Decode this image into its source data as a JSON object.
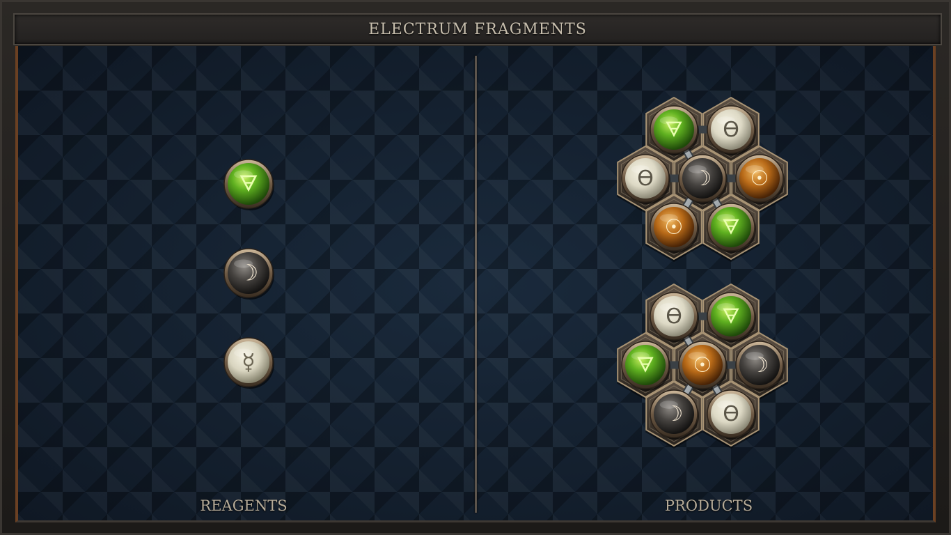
{
  "title": "ELECTRUM FRAGMENTS",
  "panels": {
    "reagents": {
      "label": "REAGENTS"
    },
    "products": {
      "label": "PRODUCTS"
    }
  },
  "colors": {
    "salt_green": "#5fb020",
    "quicksilver_pale": "#ddd9c5",
    "moon_dark": "#45423f",
    "sun_copper": "#b86a18"
  },
  "reagents": [
    {
      "element": "earth",
      "symbol": "🜃"
    },
    {
      "element": "silver",
      "symbol": "☽"
    },
    {
      "element": "quicksilver",
      "symbol": "☿"
    }
  ],
  "products": [
    {
      "atoms": [
        {
          "element": "earth",
          "symbol": "🜃"
        },
        {
          "element": "salt",
          "symbol": "ϴ"
        },
        {
          "element": "salt",
          "symbol": "ϴ"
        },
        {
          "element": "silver",
          "symbol": "☽"
        },
        {
          "element": "gold",
          "symbol": "☉"
        },
        {
          "element": "gold",
          "symbol": "☉"
        },
        {
          "element": "earth",
          "symbol": "🜃"
        }
      ]
    },
    {
      "atoms": [
        {
          "element": "salt",
          "symbol": "ϴ"
        },
        {
          "element": "earth",
          "symbol": "🜃"
        },
        {
          "element": "earth",
          "symbol": "🜃"
        },
        {
          "element": "gold",
          "symbol": "☉"
        },
        {
          "element": "silver",
          "symbol": "☽"
        },
        {
          "element": "silver",
          "symbol": "☽"
        },
        {
          "element": "salt",
          "symbol": "ϴ"
        }
      ]
    }
  ]
}
